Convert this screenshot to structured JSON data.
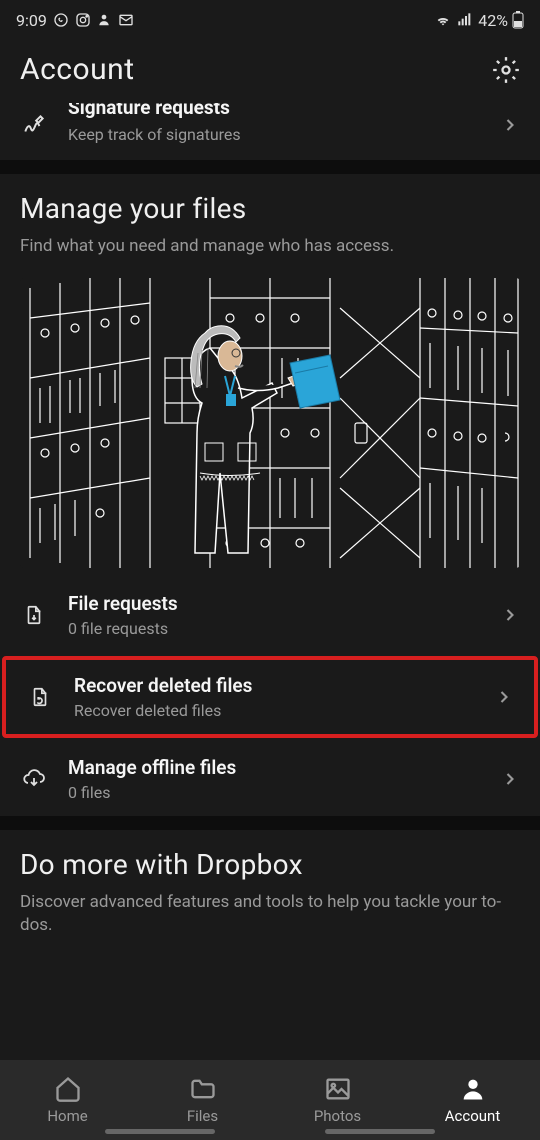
{
  "status": {
    "time": "9:09",
    "battery": "42%"
  },
  "header": {
    "title": "Account"
  },
  "signature_requests": {
    "title": "Signature requests",
    "sub": "Keep track of signatures"
  },
  "manage_files": {
    "title": "Manage your files",
    "sub": "Find what you need and manage who has access.",
    "items": [
      {
        "title": "File requests",
        "sub": "0 file requests"
      },
      {
        "title": "Recover deleted files",
        "sub": "Recover deleted files"
      },
      {
        "title": "Manage offline files",
        "sub": "0 files"
      }
    ]
  },
  "do_more": {
    "title": "Do more with Dropbox",
    "sub": "Discover advanced features and tools to help you tackle your to-dos."
  },
  "nav": {
    "home": "Home",
    "files": "Files",
    "photos": "Photos",
    "account": "Account"
  }
}
